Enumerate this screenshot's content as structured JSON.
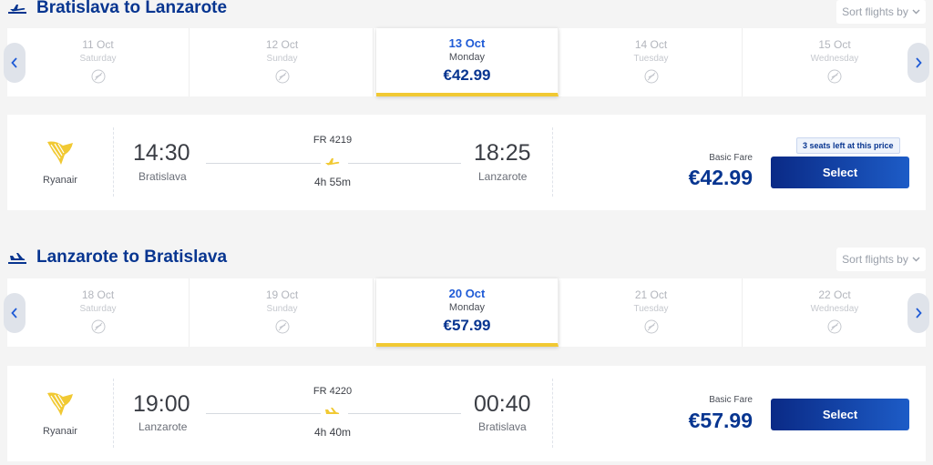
{
  "outbound": {
    "title": "Bratislava to Lanzarote",
    "sort_label": "Sort flights by",
    "dates": [
      {
        "date": "11 Oct",
        "weekday": "Saturday"
      },
      {
        "date": "12 Oct",
        "weekday": "Sunday"
      },
      {
        "date": "13 Oct",
        "weekday": "Monday",
        "price": "€42.99",
        "selected": true
      },
      {
        "date": "14 Oct",
        "weekday": "Tuesday"
      },
      {
        "date": "15 Oct",
        "weekday": "Wednesday"
      }
    ],
    "flight": {
      "airline": "Ryanair",
      "dep_time": "14:30",
      "dep_city": "Bratislava",
      "flight_no": "FR 4219",
      "duration": "4h 55m",
      "arr_time": "18:25",
      "arr_city": "Lanzarote",
      "fare_label": "Basic Fare",
      "price": "€42.99",
      "seats_left": "3 seats left at this price",
      "select_label": "Select"
    }
  },
  "return": {
    "title": "Lanzarote to Bratislava",
    "sort_label": "Sort flights by",
    "dates": [
      {
        "date": "18 Oct",
        "weekday": "Saturday"
      },
      {
        "date": "19 Oct",
        "weekday": "Sunday"
      },
      {
        "date": "20 Oct",
        "weekday": "Monday",
        "price": "€57.99",
        "selected": true
      },
      {
        "date": "21 Oct",
        "weekday": "Tuesday"
      },
      {
        "date": "22 Oct",
        "weekday": "Wednesday"
      }
    ],
    "flight": {
      "airline": "Ryanair",
      "dep_time": "19:00",
      "dep_city": "Lanzarote",
      "flight_no": "FR 4220",
      "duration": "4h 40m",
      "arr_time": "00:40",
      "arr_city": "Bratislava",
      "fare_label": "Basic Fare",
      "price": "€57.99",
      "select_label": "Select"
    }
  },
  "colors": {
    "brand_blue": "#073590",
    "accent_yellow": "#f1c933",
    "select_button": "#0a2a86"
  },
  "icons": {
    "takeoff": "plane-takeoff-icon",
    "landing": "plane-landing-icon",
    "no_flights": "no-flights-icon",
    "prev": "chevron-left-icon",
    "next": "chevron-right-icon",
    "sort": "chevron-down-icon"
  }
}
